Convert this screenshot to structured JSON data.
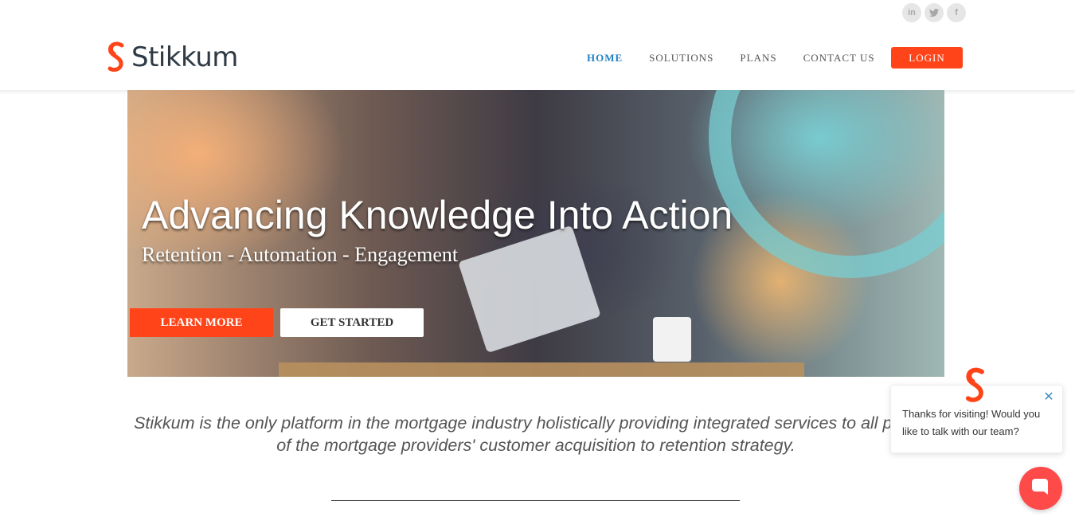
{
  "social": {
    "linkedin": "in",
    "twitter": "t",
    "facebook": "f"
  },
  "brand": {
    "name": "Stikkum",
    "accent": "#ff4419",
    "nav_active": "#1f7fc4"
  },
  "nav": {
    "items": [
      {
        "label": "HOME",
        "active": true
      },
      {
        "label": "SOLUTIONS",
        "active": false
      },
      {
        "label": "PLANS",
        "active": false
      },
      {
        "label": "CONTACT US",
        "active": false
      }
    ],
    "login_label": "LOGIN"
  },
  "hero": {
    "title": "Advancing Knowledge Into Action",
    "subtitle": "Retention - Automation - Engagement",
    "learn_more_label": "LEARN MORE",
    "get_started_label": "GET STARTED"
  },
  "tagline": {
    "text": "Stikkum is the only platform in the mortgage industry holistically providing integrated services to all phases of the mortgage providers' customer acquisition to retention strategy."
  },
  "chat": {
    "message": "Thanks for visiting! Would you like to talk with our team?",
    "close_icon": "close-icon",
    "launcher_icon": "chat-bubble-icon"
  }
}
